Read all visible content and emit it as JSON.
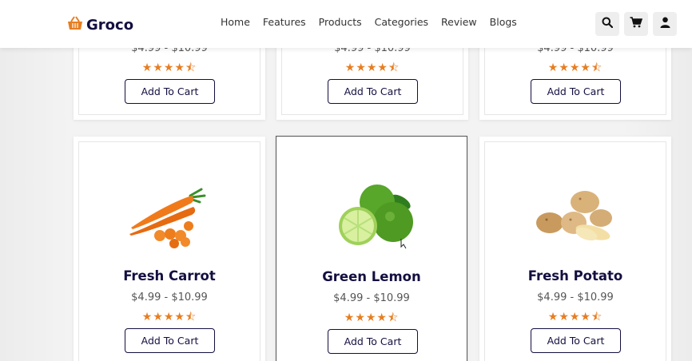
{
  "brand": {
    "name": "Groco"
  },
  "nav": {
    "items": [
      {
        "label": "Home"
      },
      {
        "label": "Features"
      },
      {
        "label": "Products"
      },
      {
        "label": "Categories"
      },
      {
        "label": "Review"
      },
      {
        "label": "Blogs"
      }
    ]
  },
  "header_icons": [
    "search-icon",
    "cart-icon",
    "user-icon"
  ],
  "colors": {
    "accent": "#e67e22",
    "dark": "#130f40"
  },
  "top_row": [
    {
      "price": "$4.99 - $10.99",
      "rating": 4.5,
      "button": "Add To Cart"
    },
    {
      "price": "$4.99 - $10.99",
      "rating": 4.5,
      "button": "Add To Cart"
    },
    {
      "price": "$4.99 - $10.99",
      "rating": 4.5,
      "button": "Add To Cart"
    }
  ],
  "products": [
    {
      "name": "Fresh Carrot",
      "price": "$4.99 - $10.99",
      "rating": 4.5,
      "button": "Add To Cart",
      "image": "carrot"
    },
    {
      "name": "Green Lemon",
      "price": "$4.99 - $10.99",
      "rating": 4.5,
      "button": "Add To Cart",
      "image": "lemon"
    },
    {
      "name": "Fresh Potato",
      "price": "$4.99 - $10.99",
      "rating": 4.5,
      "button": "Add To Cart",
      "image": "potato"
    }
  ]
}
